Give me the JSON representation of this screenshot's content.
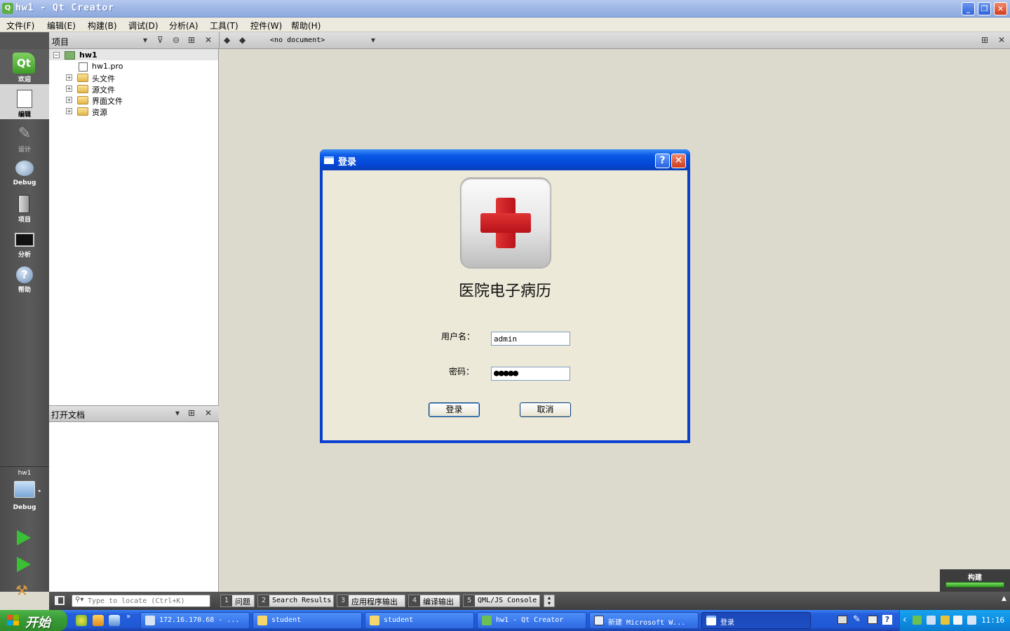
{
  "window": {
    "title": "hw1 - Qt Creator"
  },
  "menu": [
    "文件(F)",
    "编辑(E)",
    "构建(B)",
    "调试(D)",
    "分析(A)",
    "工具(T)",
    "控件(W)",
    "帮助(H)"
  ],
  "modes": [
    {
      "label": "欢迎",
      "icon": "qt-logo-icon"
    },
    {
      "label": "编辑",
      "icon": "edit-document-icon"
    },
    {
      "label": "设计",
      "icon": "design-pen-icon"
    },
    {
      "label": "Debug",
      "icon": "debug-bug-icon"
    },
    {
      "label": "项目",
      "icon": "project-folder-icon"
    },
    {
      "label": "分析",
      "icon": "analyze-monitor-icon"
    },
    {
      "label": "帮助",
      "icon": "help-question-icon"
    }
  ],
  "target": {
    "project": "hw1",
    "config": "Debug"
  },
  "panel": {
    "title": "项目"
  },
  "editor": {
    "doc": "<no document>"
  },
  "tree": {
    "root": "hw1",
    "items": [
      "hw1.pro",
      "头文件",
      "源文件",
      "界面文件",
      "资源"
    ]
  },
  "opendocs": {
    "title": "打开文档"
  },
  "build": {
    "label": "构建"
  },
  "locate": {
    "placeholder": "Type to locate (Ctrl+K)"
  },
  "outtabs": [
    {
      "num": "1",
      "label": "问题"
    },
    {
      "num": "2",
      "label": "Search Results"
    },
    {
      "num": "3",
      "label": "应用程序输出"
    },
    {
      "num": "4",
      "label": "编译输出"
    },
    {
      "num": "5",
      "label": "QML/JS Console"
    }
  ],
  "dialog": {
    "title": "登录",
    "app_title": "医院电子病历",
    "user_label": "用户名：",
    "user_value": "admin",
    "pass_label": "密码：",
    "pass_value": "●●●●●",
    "login_btn": "登录",
    "cancel_btn": "取消"
  },
  "taskbar": {
    "start": "开始",
    "tasks": [
      "172.16.170.68 - ...",
      "student",
      "student",
      "hw1 - Qt Creator",
      "新建 Microsoft W...",
      "登录"
    ],
    "clock": "11:16"
  }
}
